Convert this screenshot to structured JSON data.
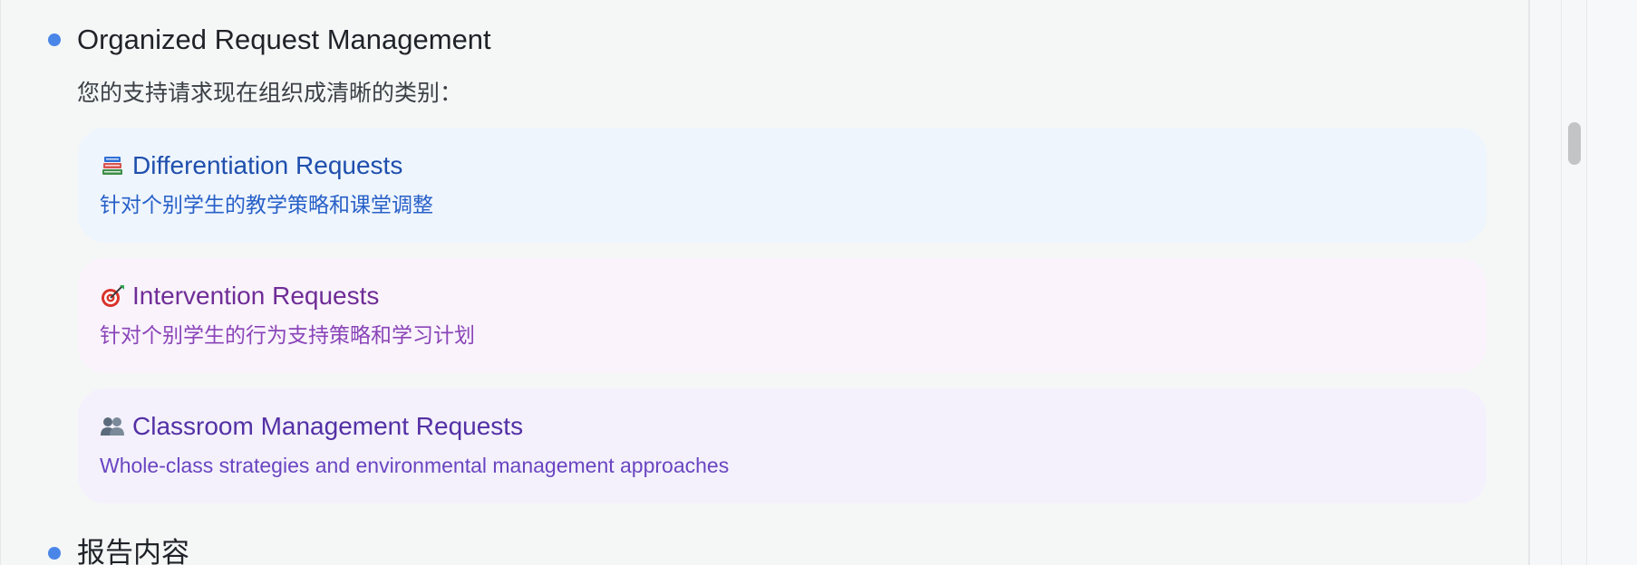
{
  "section_1": {
    "title": "Organized Request Management",
    "intro": "您的支持请求现在组织成清晰的类别："
  },
  "categories": [
    {
      "icon": "books-icon",
      "title": "Differentiation Requests",
      "description": "针对个别学生的教学策略和课堂调整",
      "title_color": "#1f4fad",
      "background": "#eef5fd"
    },
    {
      "icon": "target-icon",
      "title": "Intervention Requests",
      "description": "针对个别学生的行为支持策略和学习计划",
      "title_color": "#6f2d96",
      "background": "#faf3fc"
    },
    {
      "icon": "people-icon",
      "title": "Classroom Management Requests",
      "description": "Whole-class strategies and environmental management approaches",
      "title_color": "#5330a5",
      "background": "#f4f1fc"
    }
  ],
  "section_2": {
    "title": "报告内容"
  },
  "colors": {
    "bullet": "#4a86e8",
    "page_background": "#f5f7f7"
  }
}
